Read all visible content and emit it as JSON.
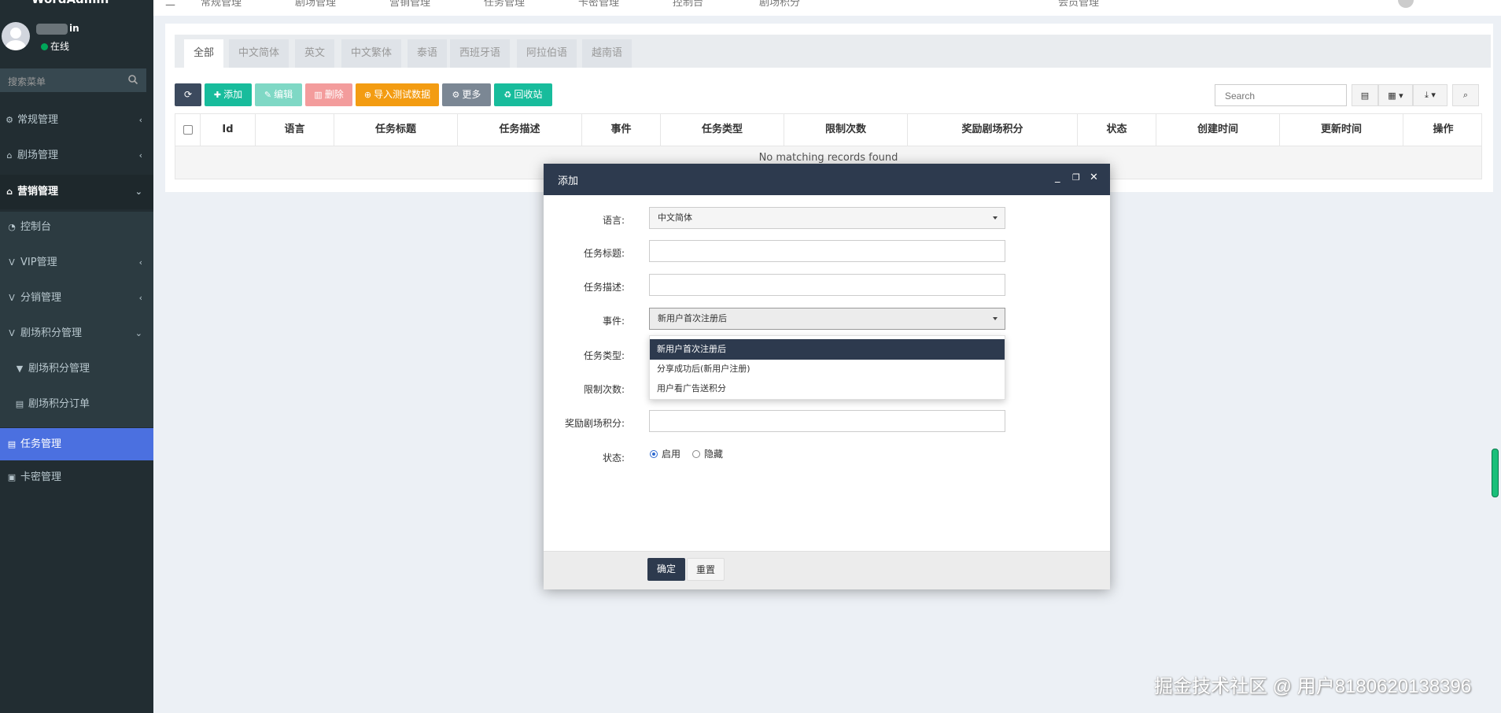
{
  "topbar": {
    "fragments": [
      "二",
      "常规管理",
      "剧场管理",
      "营销管理",
      "任务管理",
      "卡密管理",
      "控制台",
      "剧场积分",
      "会员管理"
    ]
  },
  "sidebar": {
    "brand": "WordAdmin",
    "user": {
      "name_suffix": "in",
      "status": "在线"
    },
    "search_placeholder": "搜索菜单",
    "items": [
      {
        "label": "常规管理",
        "icon": "cogs-icon"
      },
      {
        "label": "剧场管理",
        "icon": "home-icon"
      },
      {
        "label": "营销管理",
        "icon": "home-icon"
      },
      {
        "label": "控制台",
        "icon": "dashboard-icon"
      },
      {
        "label": "VIP管理",
        "icon": "v-icon"
      },
      {
        "label": "分销管理",
        "icon": "v-icon"
      },
      {
        "label": "剧场积分管理",
        "icon": "v-icon"
      },
      {
        "label": "剧场积分管理",
        "icon": "v-square-icon"
      },
      {
        "label": "剧场积分订单",
        "icon": "file-icon"
      },
      {
        "label": "任务管理",
        "icon": "file-icon"
      },
      {
        "label": "卡密管理",
        "icon": "card-icon"
      }
    ]
  },
  "tabs": [
    "全部",
    "中文简体",
    "英文",
    "中文繁体",
    "泰语",
    "西班牙语",
    "阿拉伯语",
    "越南语"
  ],
  "toolbar": {
    "refresh": "",
    "add": "添加",
    "edit": "编辑",
    "delete": "删除",
    "import": "导入测试数据",
    "more": "更多",
    "recycle": "回收站",
    "search_placeholder": "Search"
  },
  "table": {
    "columns": [
      "",
      "Id",
      "语言",
      "任务标题",
      "任务描述",
      "事件",
      "任务类型",
      "限制次数",
      "奖励剧场积分",
      "状态",
      "创建时间",
      "更新时间",
      "操作"
    ],
    "empty_text": "No matching records found"
  },
  "modal": {
    "title": "添加",
    "fields": {
      "lang_label": "语言:",
      "lang_value": "中文简体",
      "title_label": "任务标题:",
      "desc_label": "任务描述:",
      "event_label": "事件:",
      "event_value": "新用户首次注册后",
      "type_label": "任务类型:",
      "limit_label": "限制次数:",
      "reward_label": "奖励剧场积分:",
      "status_label": "状态:",
      "status_on": "启用",
      "status_off": "隐藏"
    },
    "event_options": [
      "新用户首次注册后",
      "分享成功后(新用户注册)",
      "用户看广告送积分"
    ],
    "confirm": "确定",
    "reset": "重置"
  },
  "watermark": "掘金技术社区 @ 用户8180620138396",
  "colors": {
    "sidebar": "#222d32",
    "active": "#4b70e0",
    "modal_header": "#2d3a4e",
    "add": "#18bc9c",
    "delete": "#f39c9c",
    "import": "#f39c12",
    "more": "#7b8794"
  }
}
